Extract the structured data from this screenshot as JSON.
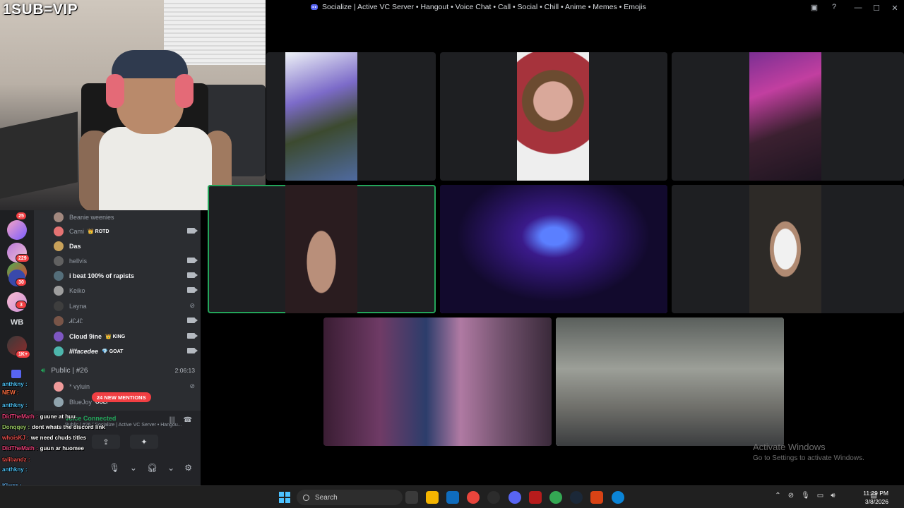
{
  "overlay": {
    "sub_text": "1SUB=VIP"
  },
  "window": {
    "title": "Socialize | Active VC Server • Hangout • Voice Chat • Call • Social • Chill • Anime • Memes • Emojis"
  },
  "servers": [
    {
      "badge": "25"
    },
    {
      "badge": ""
    },
    {
      "badge": "229"
    },
    {
      "badge": "30"
    },
    {
      "badge": "3"
    },
    {
      "label": "WB"
    },
    {
      "badge": "1K+"
    }
  ],
  "members": [
    {
      "name": "Beanie weenies",
      "tag": "",
      "icon": "none"
    },
    {
      "name": "Cami",
      "tag": "👑 ROTD",
      "icon": "camera-icon"
    },
    {
      "name": "Das",
      "tag": "",
      "icon": "none",
      "bright": true
    },
    {
      "name": "hellvis",
      "tag": "",
      "icon": "camera-icon"
    },
    {
      "name": "i beat 100% of rapists",
      "tag": "",
      "icon": "camera-icon",
      "bright": true
    },
    {
      "name": "Keiko",
      "tag": "",
      "icon": "camera-icon"
    },
    {
      "name": "Layna",
      "tag": "",
      "icon": "muted-icon"
    },
    {
      "name": "ᏗᏝᏗᏝ",
      "tag": "",
      "icon": "camera-icon"
    },
    {
      "name": "Cloud 9ine",
      "tag": "👑 KING",
      "icon": "camera-icon",
      "bright": true
    },
    {
      "name": "lilfacedee",
      "tag": "💎 GOAT",
      "icon": "camera-icon",
      "bright": true
    }
  ],
  "voice_channel": {
    "name": "Public | #26",
    "elapsed": "2:06:13"
  },
  "extra_members": [
    {
      "name": "* vyluin",
      "tag": ""
    },
    {
      "name": "BlueJoy",
      "tag": "GOLF"
    }
  ],
  "mentions": {
    "label": "24 NEW MENTIONS"
  },
  "voice_panel": {
    "status": "Voice Connected",
    "subtitle": "Public | #26 / Socialize | Active VC Server • Hangou..."
  },
  "chat": [
    {
      "user": "anthkny",
      "text": "",
      "color": "#4fc3f7"
    },
    {
      "user": "NEW",
      "text": "",
      "color": "#ff7043"
    },
    {
      "user": "anthkny",
      "text": "",
      "color": "#4fc3f7"
    },
    {
      "user": "DidTheMath",
      "text": "guune at huu",
      "color": "#ec407a"
    },
    {
      "user": "Donqqey",
      "text": "dont whats the discord link",
      "color": "#9ccc65"
    },
    {
      "user": "whoisKJ",
      "text": "we need chuds titles",
      "color": "#ef5350"
    },
    {
      "user": "DidTheMath",
      "text": "guun ar huomee",
      "color": "#ec407a"
    },
    {
      "user": "talibandz",
      "text": "",
      "color": "#ef5350"
    },
    {
      "user": "anthkny",
      "text": "",
      "color": "#4fc3f7"
    },
    {
      "user": "Klwzz",
      "text": "",
      "color": "#64b5f6"
    },
    {
      "user": "Klwzz",
      "text": "",
      "color": "#64b5f6"
    },
    {
      "user": "Klwzz",
      "text": "",
      "color": "#64b5f6"
    }
  ],
  "watermark": {
    "line1": "Activate Windows",
    "line2": "Go to Settings to activate Windows."
  },
  "taskbar": {
    "search_placeholder": "Search",
    "time": "11:29 PM",
    "date": "3/8/2026"
  },
  "colors": {
    "accent": "#5865f2",
    "speaking": "#23a55a",
    "danger": "#f23f43"
  }
}
